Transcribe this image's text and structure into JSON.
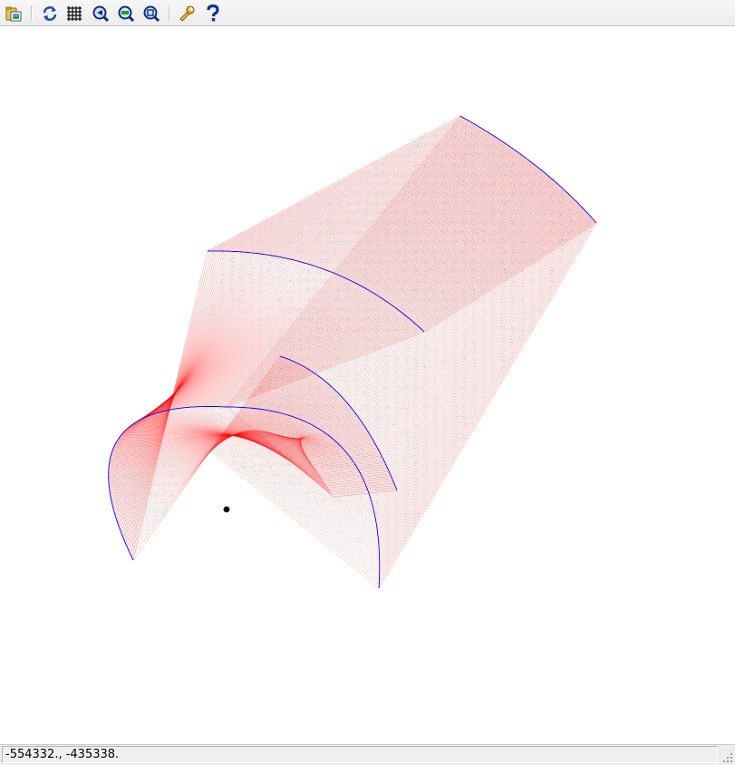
{
  "toolbar": {
    "buttons": [
      {
        "icon": "open-file-icon"
      },
      {
        "icon": "refresh-icon"
      },
      {
        "icon": "grid-icon"
      },
      {
        "icon": "zoom-back-icon"
      },
      {
        "icon": "zoom-in-icon"
      },
      {
        "icon": "zoom-fit-icon"
      },
      {
        "icon": "settings-wrench-icon"
      },
      {
        "icon": "help-icon"
      }
    ]
  },
  "statusbar": {
    "coordinates": "-554332., -435338."
  },
  "colors": {
    "ruling_lines": "#ff0000",
    "boundary_curves": "#0000ff",
    "point": "#000000",
    "background": "#ffffff"
  }
}
